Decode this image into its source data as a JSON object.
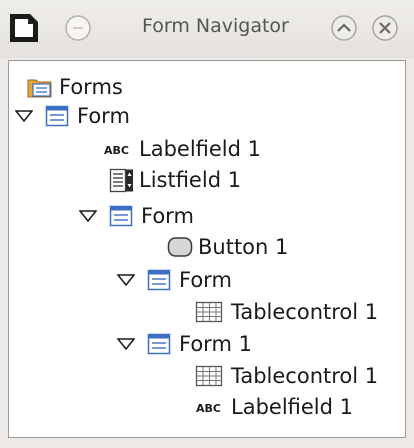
{
  "window": {
    "title": "Form Navigator",
    "icon": "document-icon",
    "buttons": [
      "window-menu-button",
      "shade-button",
      "close-button"
    ]
  },
  "tree": [
    {
      "label": "Forms",
      "icon": "forms-folder-icon",
      "expanded": null
    },
    {
      "label": "Form",
      "icon": "form-icon",
      "expanded": true
    },
    {
      "label": "Labelfield 1",
      "icon": "label-field-icon",
      "expanded": null
    },
    {
      "label": "Listfield 1",
      "icon": "list-field-icon",
      "expanded": null
    },
    {
      "label": "Form",
      "icon": "form-icon",
      "expanded": true
    },
    {
      "label": "Button 1",
      "icon": "button-control-icon",
      "expanded": null
    },
    {
      "label": "Form",
      "icon": "form-icon",
      "expanded": true
    },
    {
      "label": "Tablecontrol 1",
      "icon": "table-control-icon",
      "expanded": null
    },
    {
      "label": "Form 1",
      "icon": "form-icon",
      "expanded": true
    },
    {
      "label": "Tablecontrol 1",
      "icon": "table-control-icon",
      "expanded": null
    },
    {
      "label": "Labelfield 1",
      "icon": "label-field-icon",
      "expanded": null
    }
  ],
  "colors": {
    "form_icon_blue": "#3b6fc4",
    "folder_orange": "#e8a33a",
    "panel_bg": "#ffffff",
    "window_bg": "#ece9e6"
  }
}
